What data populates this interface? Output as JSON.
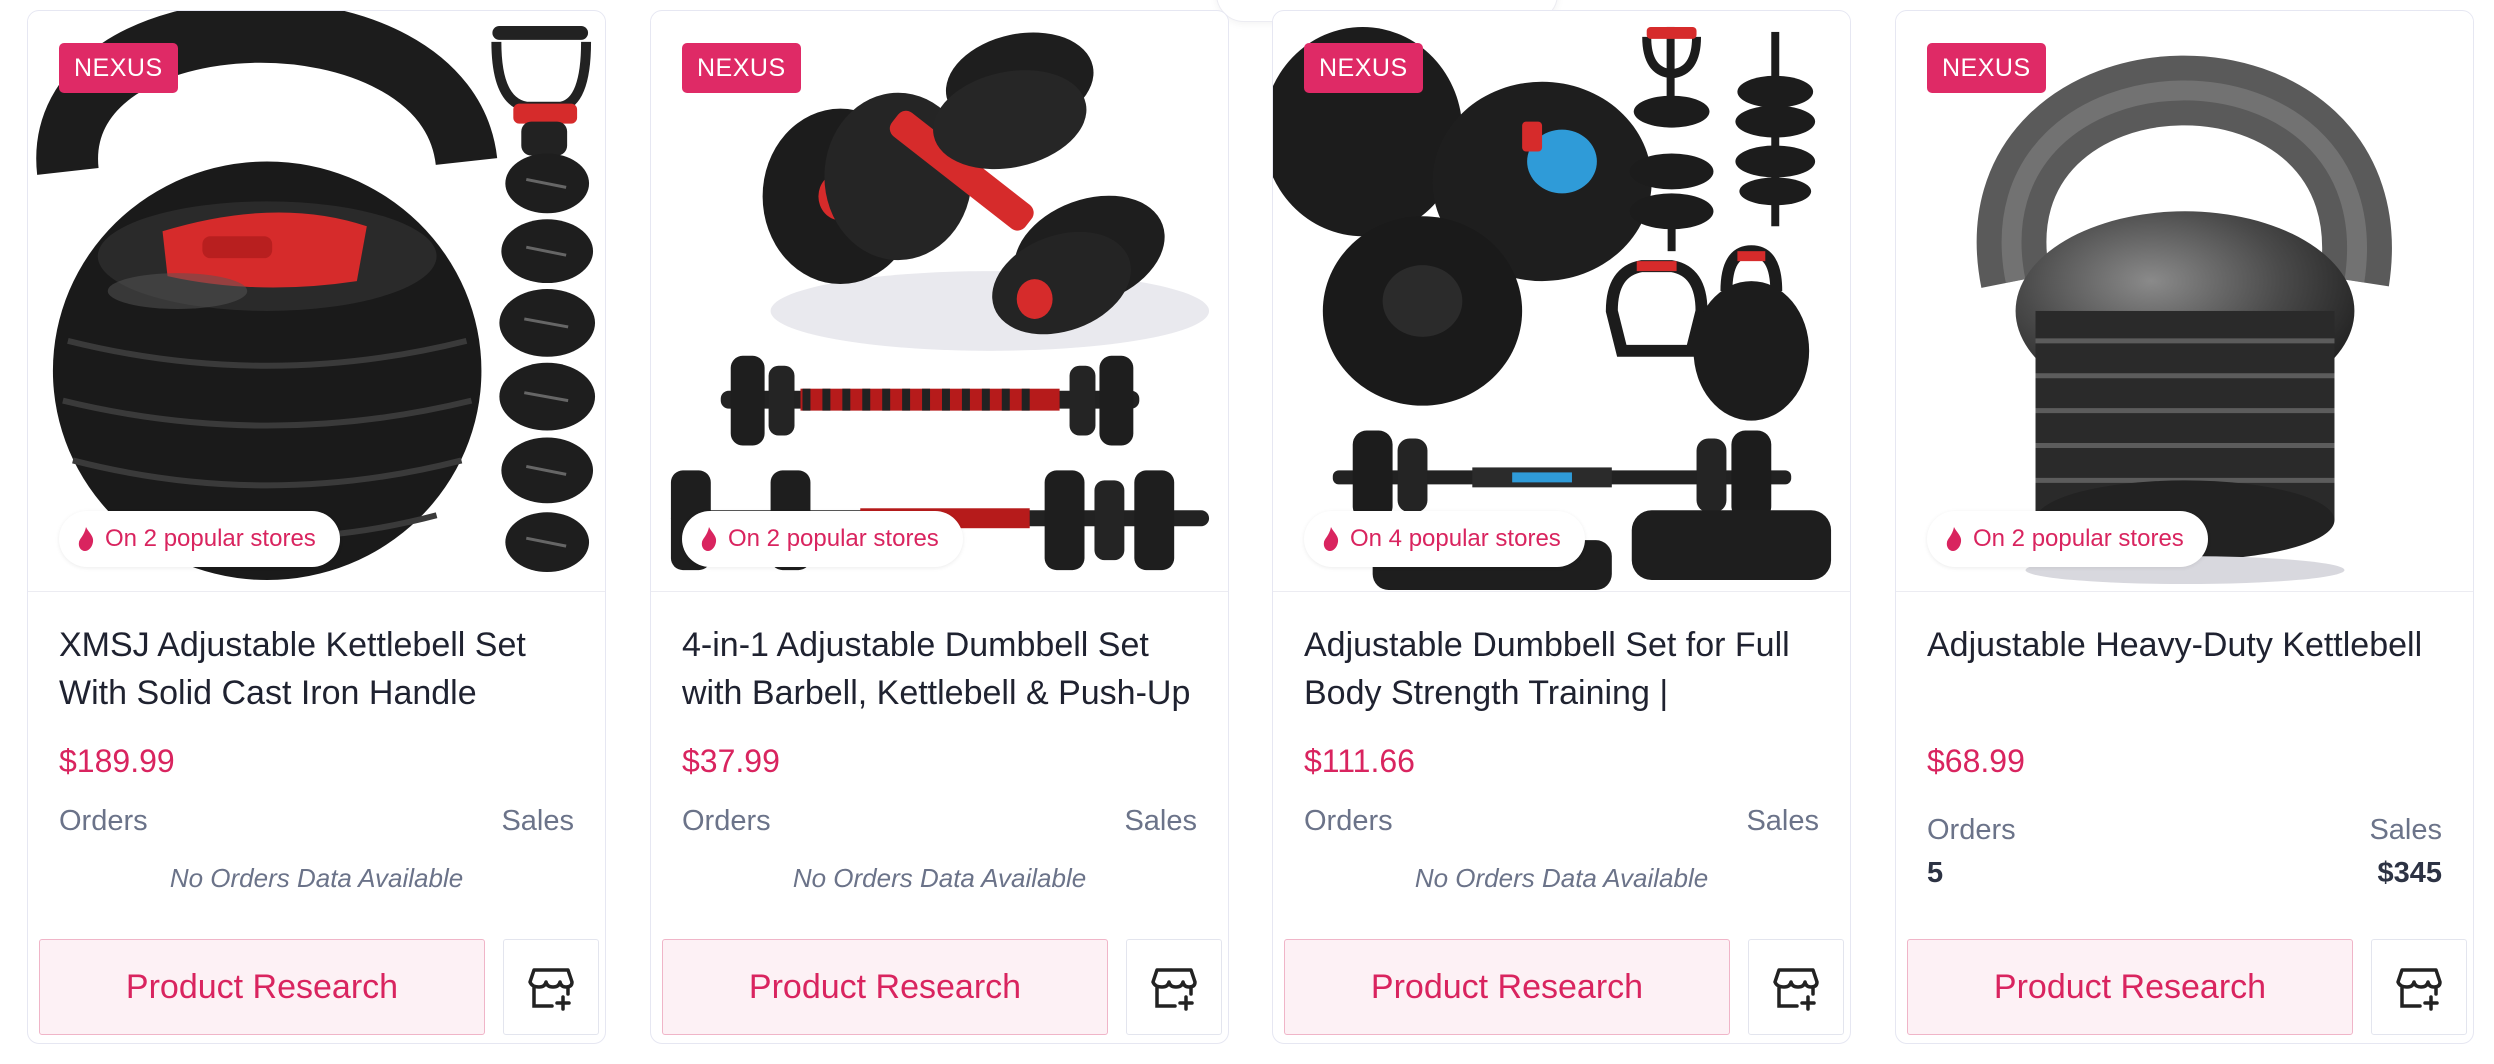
{
  "cards": [
    {
      "brand": "NEXUS",
      "popular": "On 2 popular stores",
      "title": "XMSJ Adjustable Kettlebell Set With Solid Cast Iron Handle",
      "price": "$189.99",
      "orders_label": "Orders",
      "sales_label": "Sales",
      "no_data": "No Orders Data Available",
      "research_label": "Product Research",
      "image_icon": "kettlebell-set-image"
    },
    {
      "brand": "NEXUS",
      "popular": "On 2 popular stores",
      "title": "4-in-1 Adjustable Dumbbell Set with Barbell, Kettlebell & Push-Up",
      "price": "$37.99",
      "orders_label": "Orders",
      "sales_label": "Sales",
      "no_data": "No Orders Data Available",
      "research_label": "Product Research",
      "image_icon": "dumbbell-set-image"
    },
    {
      "brand": "NEXUS",
      "popular": "On 4 popular stores",
      "title": "Adjustable Dumbbell Set for Full Body Strength Training |",
      "price": "$111.66",
      "orders_label": "Orders",
      "sales_label": "Sales",
      "no_data": "No Orders Data Available",
      "research_label": "Product Research",
      "image_icon": "dumbbell-set-image"
    },
    {
      "brand": "NEXUS",
      "popular": "On 2 popular stores",
      "title": "Adjustable Heavy-Duty Kettlebell",
      "price": "$68.99",
      "orders_label": "Orders",
      "sales_label": "Sales",
      "orders_value": "5",
      "sales_value": "$345",
      "research_label": "Product Research",
      "image_icon": "kettlebell-image"
    }
  ],
  "colors": {
    "accent": "#df2a66",
    "text_muted": "#6b7389",
    "border": "#e6e7f2"
  }
}
